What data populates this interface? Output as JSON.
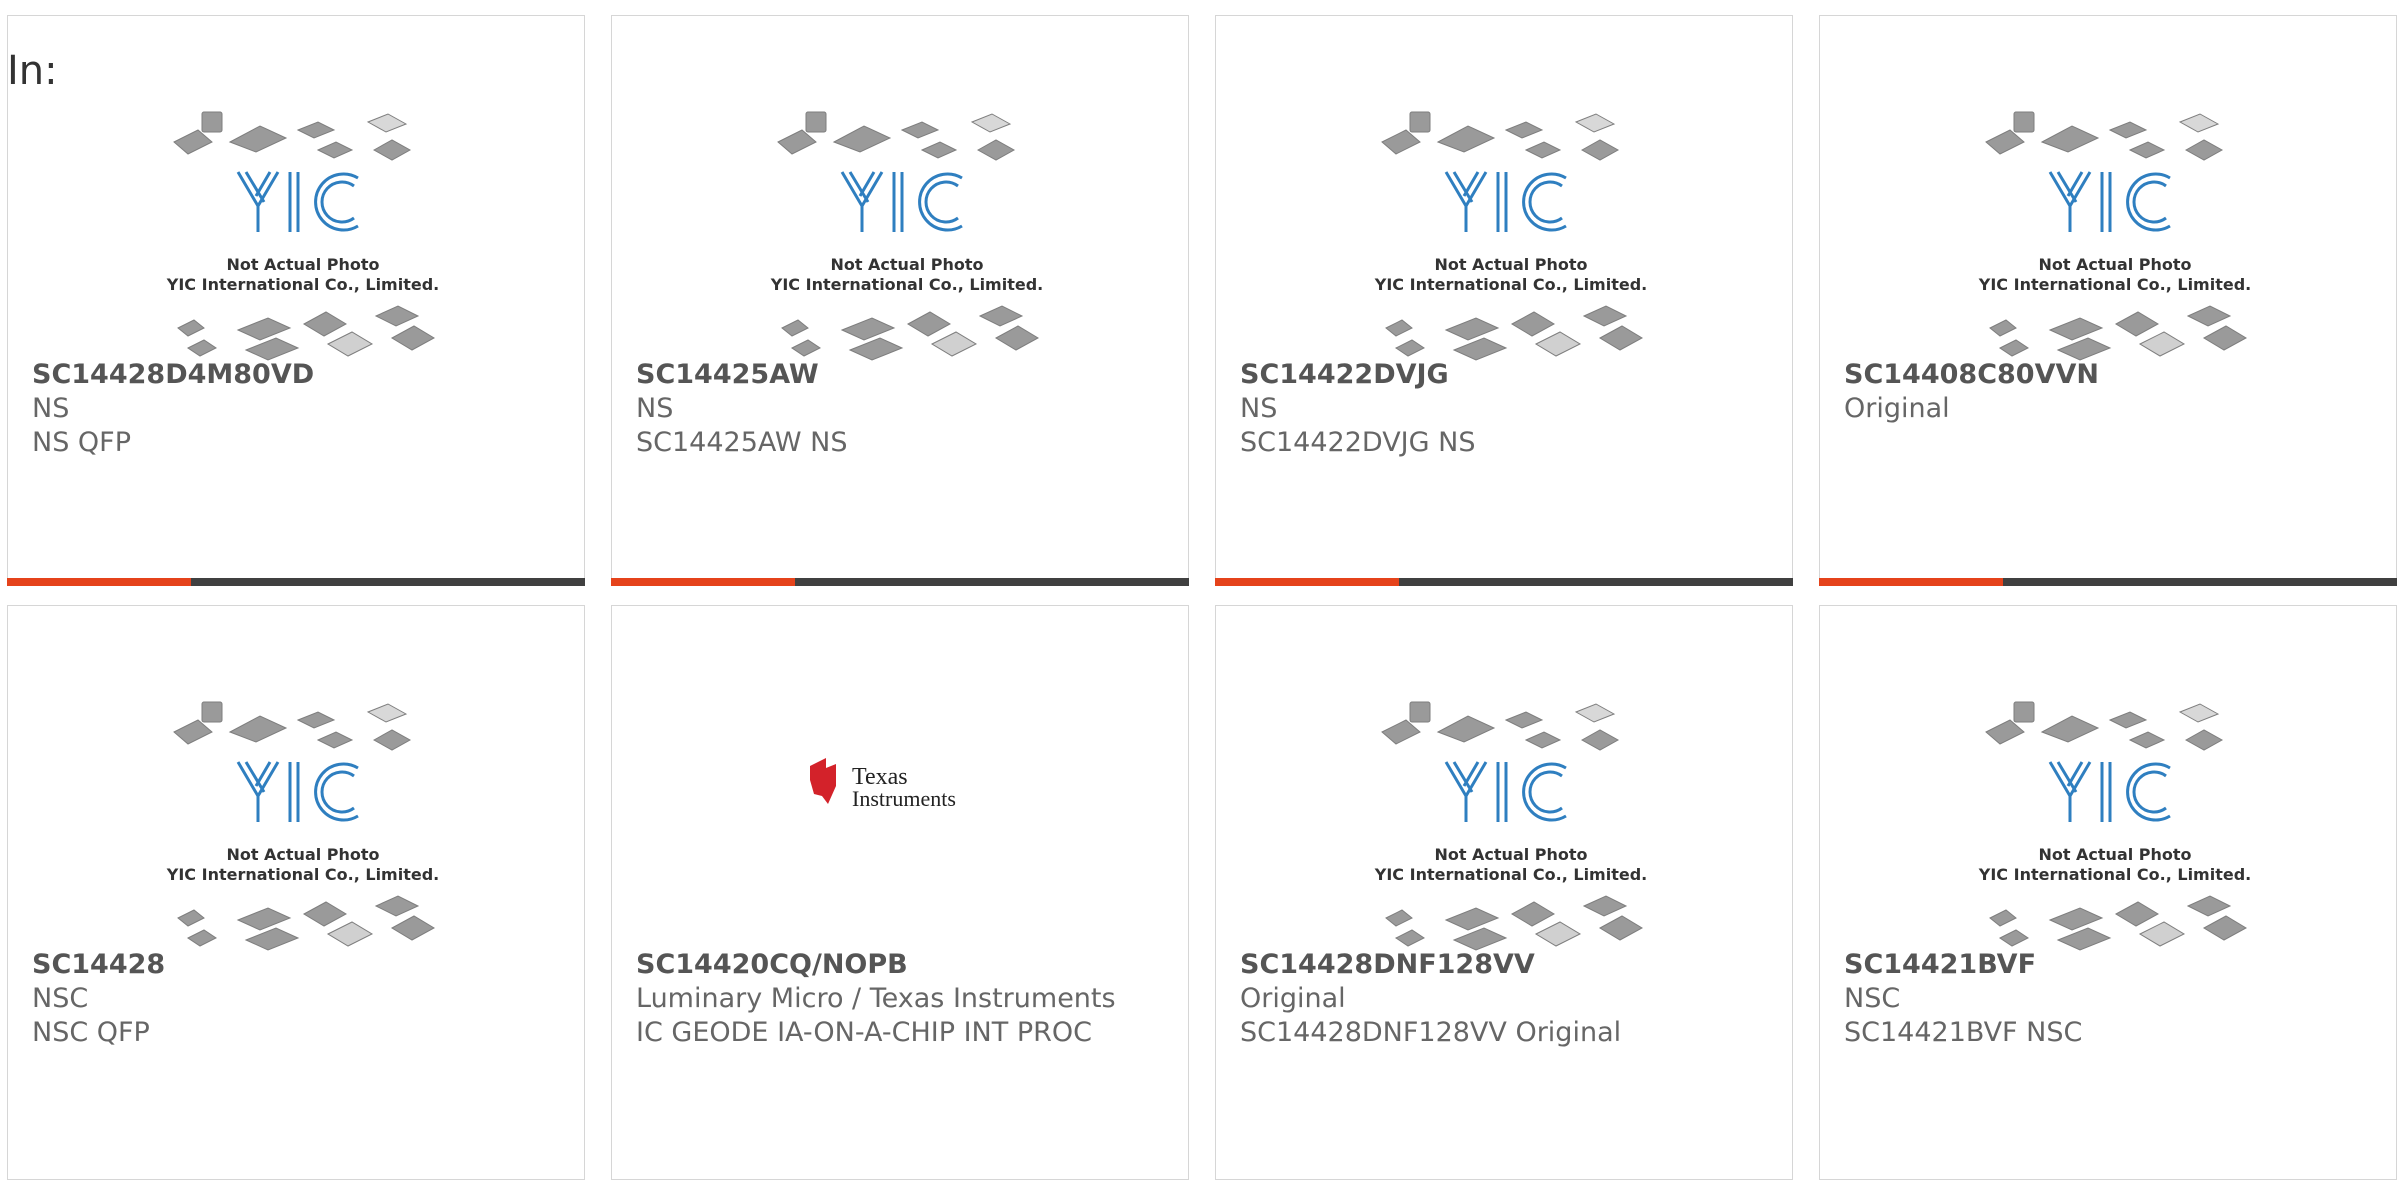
{
  "header": {
    "in_label": "In:"
  },
  "placeholder_image": {
    "logo_text": "YIC",
    "caption_line1": "Not Actual Photo",
    "caption_line2": "YIC International Co., Limited."
  },
  "ti_logo": {
    "line1": "Texas",
    "line2": "Instruments"
  },
  "colors": {
    "accent": "#e5431b",
    "bar": "#404040",
    "logo_blue": "#2f7fc0",
    "ti_red": "#d3222a"
  },
  "products": [
    {
      "part": "SC14428D4M80VD",
      "brand": "NS",
      "desc": "NS QFP",
      "image": "yic-placeholder"
    },
    {
      "part": "SC14425AW",
      "brand": "NS",
      "desc": "SC14425AW NS",
      "image": "yic-placeholder"
    },
    {
      "part": "SC14422DVJG",
      "brand": "NS",
      "desc": "SC14422DVJG NS",
      "image": "yic-placeholder"
    },
    {
      "part": "SC14408C80VVN",
      "brand": "Original",
      "desc": "",
      "image": "yic-placeholder"
    },
    {
      "part": "SC14428",
      "brand": "NSC",
      "desc": "NSC QFP",
      "image": "yic-placeholder"
    },
    {
      "part": "SC14420CQ/NOPB",
      "brand": "Luminary Micro / Texas Instruments",
      "desc": "IC GEODE IA-ON-A-CHIP INT PROC",
      "image": "texas-instruments-logo"
    },
    {
      "part": "SC14428DNF128VV",
      "brand": "Original",
      "desc": "SC14428DNF128VV Original",
      "image": "yic-placeholder"
    },
    {
      "part": "SC14421BVF",
      "brand": "NSC",
      "desc": "SC14421BVF NSC",
      "image": "yic-placeholder"
    }
  ]
}
